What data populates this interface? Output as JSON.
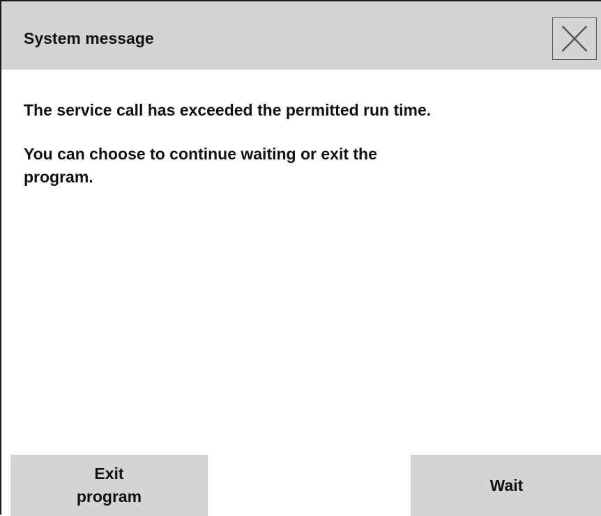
{
  "dialog": {
    "title": "System message",
    "close_icon": "close-icon",
    "message_line_1": "The service call has exceeded the permitted run time.",
    "message_line_2a": "You can choose to continue waiting or exit the",
    "message_line_2b": "program."
  },
  "buttons": {
    "exit_line_1": "Exit",
    "exit_line_2": "program",
    "wait": "Wait"
  },
  "colors": {
    "title_bar": "#d4d4d4",
    "button": "#d4d4d4",
    "background": "#ffffff",
    "text": "#111111"
  }
}
